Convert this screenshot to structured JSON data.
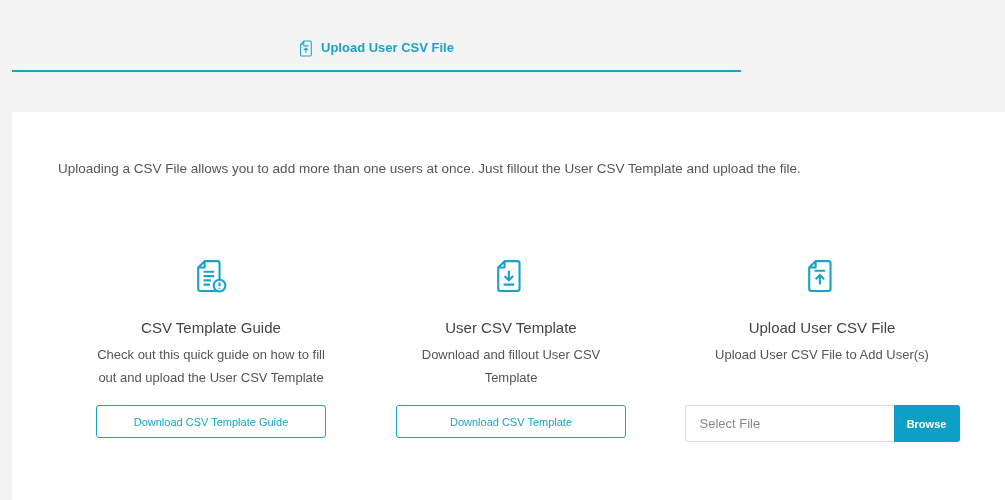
{
  "tabs": [
    {
      "label": "Upload User CSV File",
      "selected": true
    }
  ],
  "intro": "Uploading a CSV File allows you to add more than one users at once. Just fillout the User CSV Template and upload the file.",
  "cards": [
    {
      "kind": "button",
      "title": "CSV Template Guide",
      "description": "Check out this quick guide on how to fill out and upload the User CSV Template",
      "button": "Download CSV Template Guide"
    },
    {
      "kind": "button",
      "title": "User CSV Template",
      "description": "Download and fillout User CSV Template",
      "button": "Download CSV Template"
    },
    {
      "kind": "file",
      "title": "Upload User CSV File",
      "description": "Upload User CSV File to Add User(s)",
      "placeholder": "Select File",
      "button": "Browse"
    }
  ]
}
